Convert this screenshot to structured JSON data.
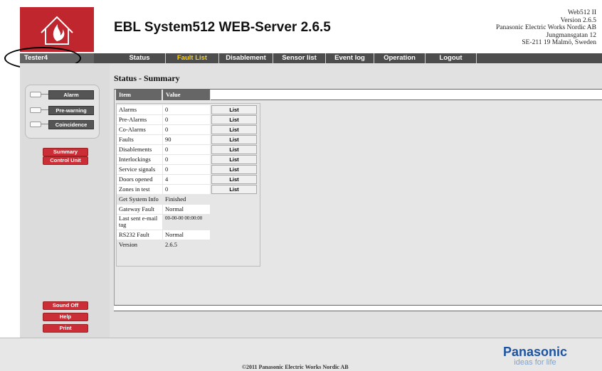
{
  "header": {
    "app_title": "EBL System512 WEB-Server 2.6.5",
    "company_lines": [
      "Web512 II",
      "Version 2.6.5",
      "Panasonic Electric Works Nordic AB",
      "Jungmansgatan 12",
      "SE-211 19 Malmö, Sweden"
    ]
  },
  "user": {
    "name": "Tester4"
  },
  "nav": {
    "items": [
      {
        "label": "Status",
        "active": false
      },
      {
        "label": "Fault List",
        "active": true
      },
      {
        "label": "Disablement",
        "active": false
      },
      {
        "label": "Sensor list",
        "active": false
      },
      {
        "label": "Event log",
        "active": false
      },
      {
        "label": "Operation",
        "active": false
      },
      {
        "label": "Logout",
        "active": false
      }
    ]
  },
  "indicators": [
    {
      "label": "Alarm"
    },
    {
      "label": "Pre-warning"
    },
    {
      "label": "Coincidence"
    }
  ],
  "side_buttons": {
    "summary": "Summary",
    "control_unit": "Control Unit",
    "sound_off": "Sound Off",
    "help": "Help",
    "print": "Print"
  },
  "section": {
    "title": "Status - Summary"
  },
  "table": {
    "headers": [
      "Item",
      "Value"
    ],
    "list_label": "List",
    "rows": [
      {
        "item": "Alarms",
        "value": "0",
        "has_list": true
      },
      {
        "item": "Pre-Alarms",
        "value": "0",
        "has_list": true
      },
      {
        "item": "Co-Alarms",
        "value": "0",
        "has_list": true
      },
      {
        "item": "Faults",
        "value": "90",
        "has_list": true
      },
      {
        "item": "Disablements",
        "value": "0",
        "has_list": true
      },
      {
        "item": "Interlockings",
        "value": "0",
        "has_list": true
      },
      {
        "item": "Service signals",
        "value": "0",
        "has_list": true
      },
      {
        "item": "Doors opened",
        "value": "4",
        "has_list": true
      },
      {
        "item": "Zones in test",
        "value": "0",
        "has_list": true
      },
      {
        "item": "Get System Info",
        "value": "Finished",
        "has_list": false
      },
      {
        "item": "Gateway Fault",
        "value": "Normal",
        "has_list": false
      },
      {
        "item": "Last sent e-mail tag",
        "value": "00-00-00 00:00:00",
        "has_list": false
      },
      {
        "item": "RS232 Fault",
        "value": "Normal",
        "has_list": false
      },
      {
        "item": "Version",
        "value": "2.6.5",
        "has_list": false
      }
    ]
  },
  "footer": {
    "copyright": "©2011 Panasonic Electric Works Nordic AB",
    "brand": "Panasonic",
    "tagline": "ideas for life"
  },
  "colors": {
    "brand_red": "#c0262d",
    "nav_bg": "#4d4d4d",
    "active_nav": "#ffd400",
    "panasonic_blue": "#1c54a5"
  }
}
